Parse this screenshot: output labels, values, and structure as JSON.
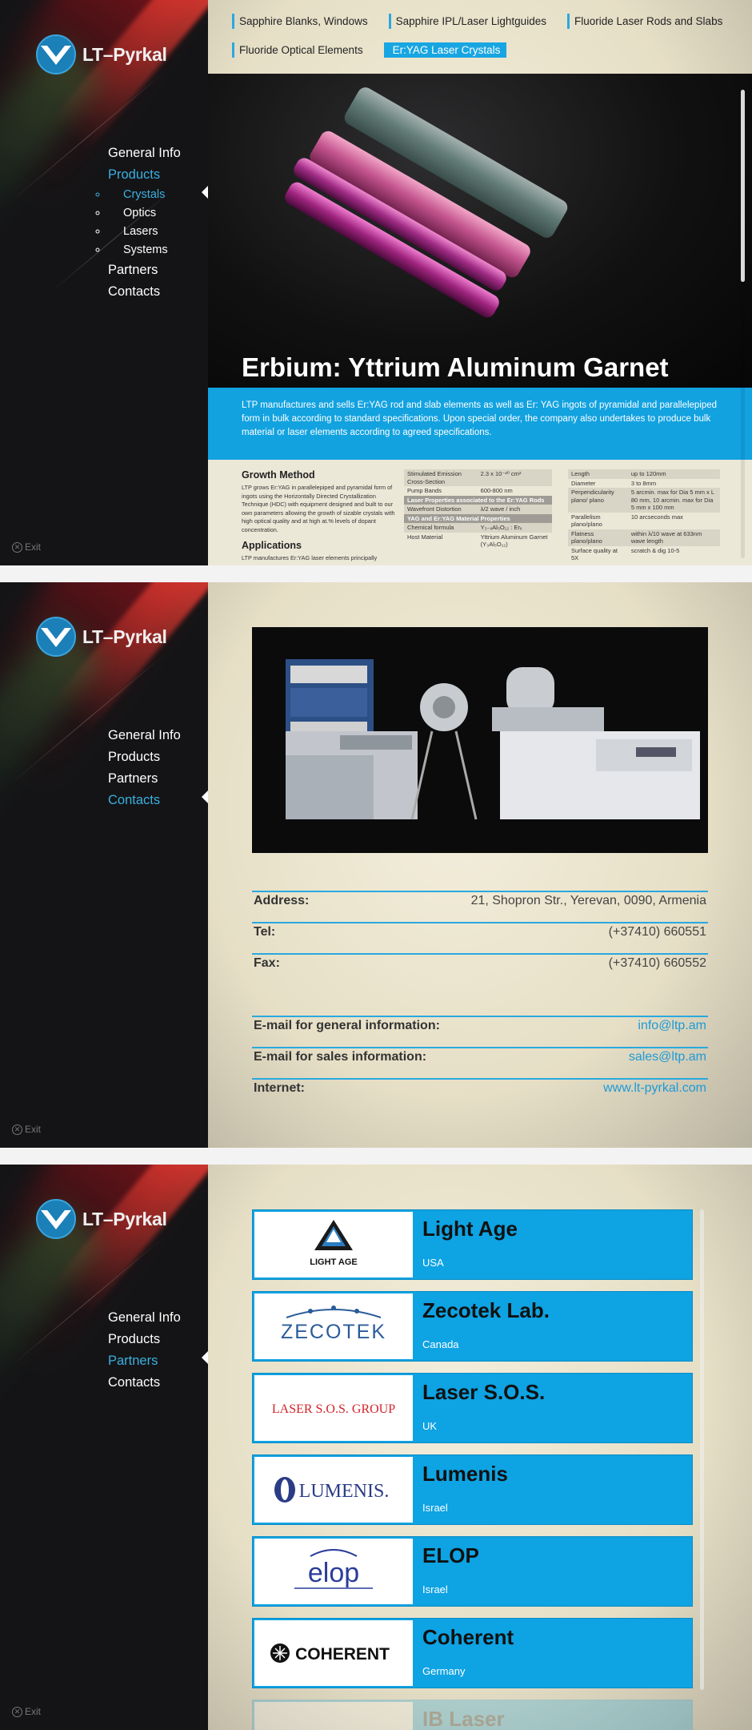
{
  "app": {
    "logo_text": "LT–Pyrkal",
    "exit_label": "Exit",
    "accent": "#1aa6e2"
  },
  "screen1": {
    "nav": [
      "General Info",
      "Products",
      "Partners",
      "Contacts"
    ],
    "subnav": [
      "Crystals",
      "Optics",
      "Lasers",
      "Systems"
    ],
    "active_nav": "Products",
    "active_sub": "Crystals",
    "tabs": [
      "Sapphire Blanks, Windows",
      "Sapphire IPL/Laser Lightguides",
      "Fluoride Laser Rods and Slabs",
      "Fluoride Optical Elements",
      "Er:YAG Laser Crystals"
    ],
    "active_tab": "Er:YAG Laser Crystals",
    "title": "Erbium: Yttrium Aluminum Garnet",
    "intro": "LTP manufactures and sells Er:YAG rod and slab elements as well as Er: YAG ingots of pyramidal and parallelepiped form in bulk according to standard specifications. Upon special order, the company also undertakes to produce bulk material or laser elements according to agreed specifications.",
    "growth_heading": "Growth Method",
    "growth_text": "LTP grows Er:YAG in parallelepiped and pyramidal form of ingots using the Horizontally Directed Crystallization Technique (HDC) with equipment designed and built to our own parameters allowing the growth of sizable crystals with high optical quality and at high at.% levels of dopant concentration.",
    "apps_heading": "Applications",
    "apps_text": "LTP manufactures Er:YAG laser elements principally",
    "spec_mid": [
      [
        "Stimulated Emission Cross-Section",
        "2.3 x 10⁻²⁰ cm²"
      ],
      [
        "Pump Bands",
        "600-800 nm"
      ],
      [
        "Laser Properties associated to the Er:YAG Rods",
        ""
      ],
      [
        "Wavefront Distortion",
        "λ/2 wave / inch"
      ],
      [
        "YAG and Er:YAG Material Properties",
        ""
      ],
      [
        "Chemical formula",
        "Y₃₋ₓAl₅O₁₂ : Erₓ"
      ],
      [
        "Host Material",
        "Yttrium Aluminum Garnet (Y₃Al₅O₁₂)"
      ]
    ],
    "spec_right": [
      [
        "Length",
        "up to 120mm"
      ],
      [
        "Diameter",
        "3 to 8mm"
      ],
      [
        "Perpendicularity plano/ plano",
        "5 arcmin. max for Dia 5 mm x L 80 mm, 10 arcmin. max for Dia 5 mm x 100 mm"
      ],
      [
        "Parallelism plano/plano",
        "10 arcseconds max"
      ],
      [
        "Flatness plano/plano",
        "within λ/10 wave at 633nm wave length"
      ],
      [
        "Surface quality at 5X",
        "scratch & dig 10-5"
      ]
    ]
  },
  "screen2": {
    "nav": [
      "General Info",
      "Products",
      "Partners",
      "Contacts"
    ],
    "active_nav": "Contacts",
    "contacts": [
      {
        "label": "Address:",
        "value": "21, Shopron Str., Yerevan, 0090, Armenia"
      },
      {
        "label": "Tel:",
        "value": "(+37410) 660551"
      },
      {
        "label": "Fax:",
        "value": "(+37410) 660552"
      },
      {
        "label": "E-mail for general information:",
        "value": "info@ltp.am"
      },
      {
        "label": "E-mail for sales information:",
        "value": "sales@ltp.am"
      },
      {
        "label": "Internet:",
        "value": "www.lt-pyrkal.com"
      }
    ]
  },
  "screen3": {
    "nav": [
      "General Info",
      "Products",
      "Partners",
      "Contacts"
    ],
    "active_nav": "Partners",
    "partners": [
      {
        "name": "Light Age",
        "country": "USA",
        "logo": "LIGHT AGE"
      },
      {
        "name": "Zecotek Lab.",
        "country": "Canada",
        "logo": "ZECOTEK"
      },
      {
        "name": "Laser S.O.S.",
        "country": "UK",
        "logo": "LASER S.O.S. GROUP"
      },
      {
        "name": "Lumenis",
        "country": "Israel",
        "logo": "LUMENIS."
      },
      {
        "name": "ELOP",
        "country": "Israel",
        "logo": "elop"
      },
      {
        "name": "Coherent",
        "country": "Germany",
        "logo": "COHERENT"
      },
      {
        "name": "IB Laser",
        "country": "",
        "logo": ""
      }
    ]
  }
}
